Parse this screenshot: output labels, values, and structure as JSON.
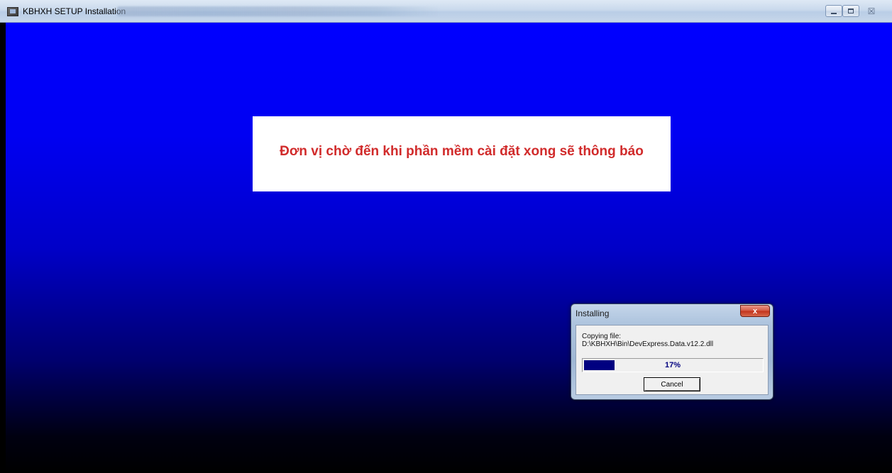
{
  "window": {
    "title": "KBHXH SETUP Installation",
    "icon": "setup-app-icon",
    "controls": {
      "minimize_icon": "minimize-icon",
      "maximize_icon": "restore-icon",
      "close_glyph": "☒"
    }
  },
  "notice": {
    "text": "Đơn vị chờ đến khi phần mềm cài đặt xong sẽ thông báo",
    "color": "#d12b2b"
  },
  "dialog": {
    "title": "Installing",
    "close_glyph": "x",
    "status_label": "Copying file:",
    "file_path": "D:\\KBHXH\\Bin\\DevExpress.Data.v12.2.dll",
    "progress": {
      "percent": 17,
      "label": "17%",
      "fill_color": "#000080"
    },
    "cancel_label": "Cancel"
  },
  "colors": {
    "background_top": "#0000ff",
    "background_bottom": "#000000"
  }
}
